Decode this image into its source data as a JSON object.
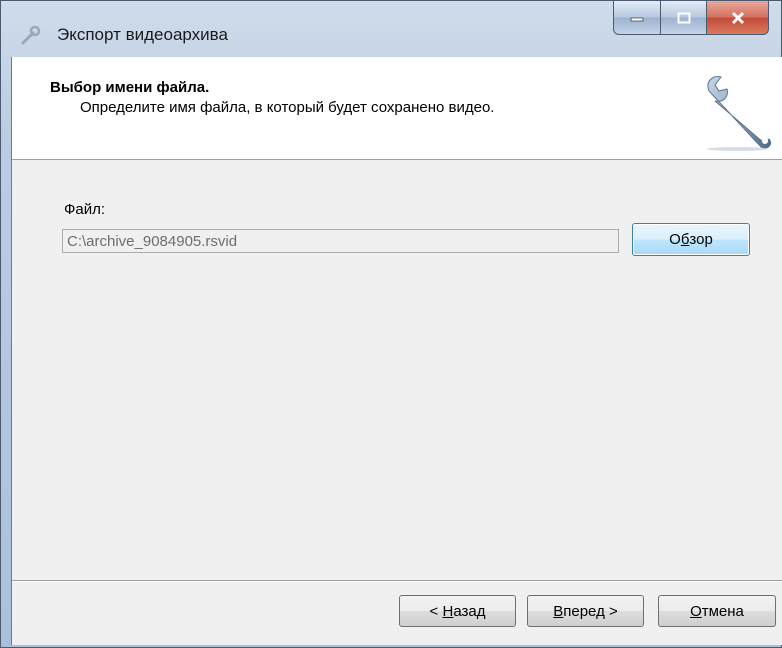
{
  "window": {
    "title": "Экспорт видеоархива"
  },
  "header": {
    "title": "Выбор имени файла.",
    "subtitle": "Определите имя файла, в который будет сохранено видео."
  },
  "file": {
    "label": "Файл:",
    "value": "C:\\archive_9084905.rsvid",
    "browse_pre": "О",
    "browse_key": "б",
    "browse_post": "зор"
  },
  "footer": {
    "back_pre": "< ",
    "back_key": "Н",
    "back_post": "азад",
    "next_key": "В",
    "next_post": "перед >",
    "cancel_key": "О",
    "cancel_post": "тмена"
  },
  "icons": {
    "app": "wrench-icon",
    "header": "wrench-icon",
    "minimize": "minimize-icon",
    "maximize": "maximize-icon",
    "close": "close-icon"
  }
}
